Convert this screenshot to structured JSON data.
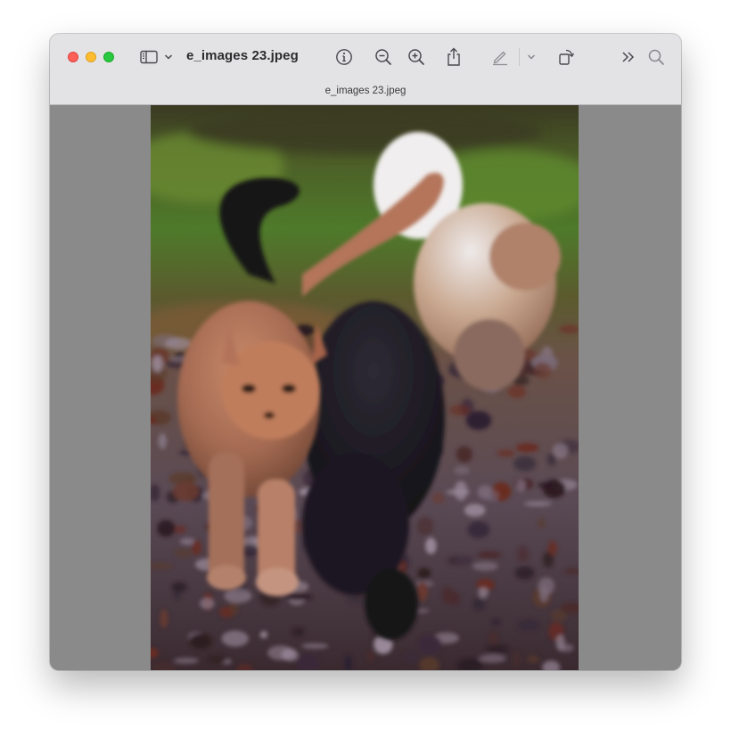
{
  "window": {
    "title": "e_images 23.jpeg",
    "document_tab": "e_images 23.jpeg"
  },
  "toolbar": {
    "icons": [
      "sidebar-icon",
      "chevron-down-icon",
      "info-icon",
      "zoom-out-icon",
      "zoom-in-icon",
      "share-icon",
      "markup-pen-icon",
      "chevron-down-icon",
      "rotate-icon",
      "more-icon",
      "search-icon"
    ]
  },
  "image": {
    "description_icon": "photo",
    "background": "#8a8a8a"
  },
  "colors": {
    "close": "#fe5f57",
    "minimize": "#febc2e",
    "maximize": "#28c840",
    "titlebar": "#e3e3e6",
    "canvas": "#8a8a8a"
  }
}
